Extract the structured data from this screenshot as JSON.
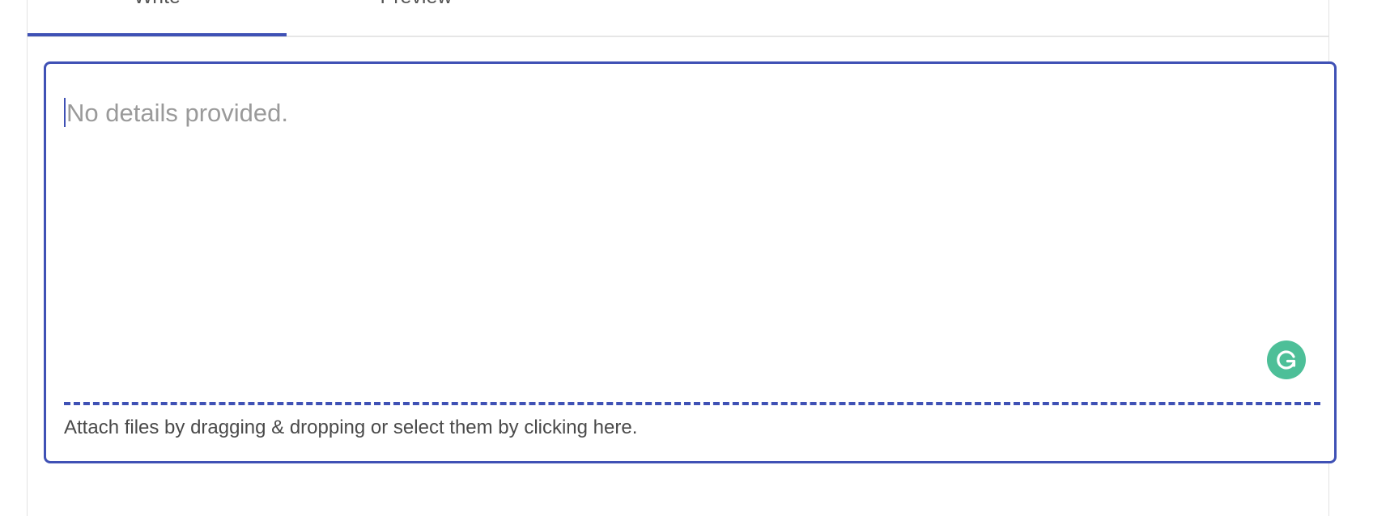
{
  "tabs": [
    {
      "label": "Write",
      "active": true
    },
    {
      "label": "Preview",
      "active": false
    }
  ],
  "editor": {
    "placeholder": "No details provided.",
    "value": ""
  },
  "attach": {
    "text": "Attach files by dragging & dropping or select them by clicking here."
  },
  "colors": {
    "accent": "#3f51b5",
    "grammarly": "#4dbf98"
  },
  "icons": {
    "grammarly": "grammarly-icon"
  }
}
